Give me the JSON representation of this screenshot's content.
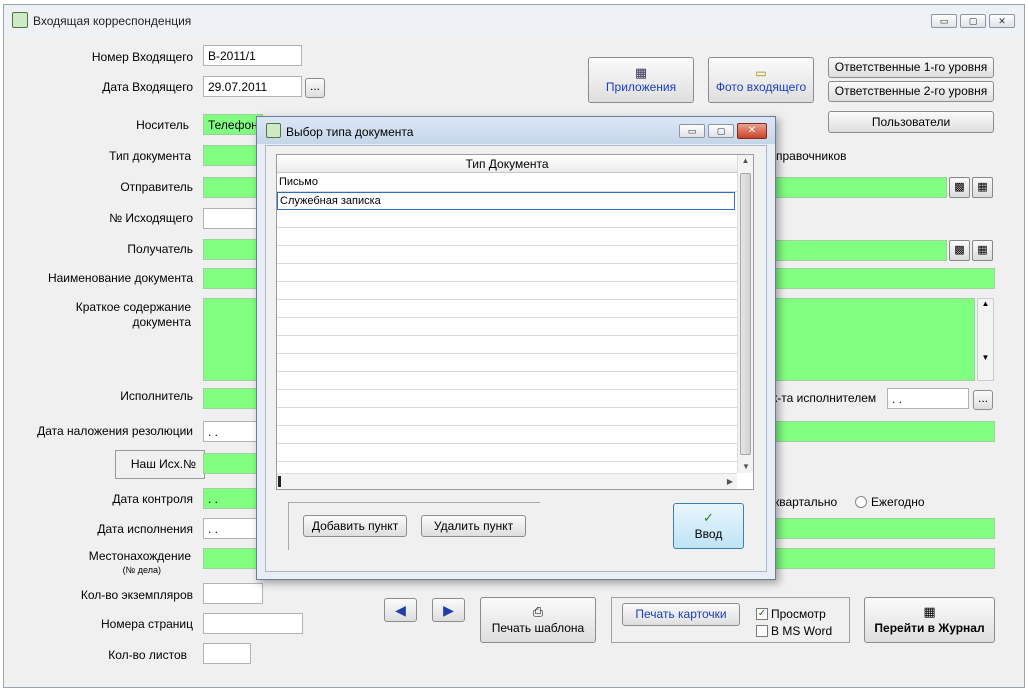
{
  "window": {
    "title": "Входящая корреспонденция",
    "controls": [
      "▭",
      "▢",
      "✕"
    ]
  },
  "labels": {
    "nomer": "Номер Входящего",
    "data": "Дата Входящего",
    "nositel": "Носитель",
    "tip": "Тип документа",
    "otpravitel": "Отправитель",
    "nomer_ish": "№ Исходящего",
    "poluchatel": "Получатель",
    "naimenovanie": "Наименование документа",
    "kratkoe1": "Краткое содержание",
    "kratkoe2": "документа",
    "ispolnitel": "Исполнитель",
    "data_rez": "Дата наложения резолюции",
    "nash_ish": "Наш Исх.№",
    "data_kontrol": "Дата контроля",
    "data_isp": "Дата исполнения",
    "mesto": "Местонахождение",
    "mesto_sub": "(№ дела)",
    "kol_ekz": "Кол-во экземпляров",
    "nomera_str": "Номера страниц",
    "kol_list": "Кол-во листов",
    "spravochnikov": "правочников",
    "ispolnitelem": "к-та исполнителем",
    "kvartalno": "квартально",
    "ezhegodno": "Ежегодно"
  },
  "values": {
    "nomer": "В-2011/1",
    "data": "29.07.2011",
    "nositel": "Телефон",
    "data_rez": " . .",
    "data_kontrol": " . .",
    "data_isp": " . .",
    "ispolnitelem_date": "  . ."
  },
  "buttons": {
    "ellipsis": "...",
    "prilozheniya": "Приложения",
    "foto": "Фото входящего",
    "otv1": "Ответственные 1-го уровня",
    "otv2": "Ответственные 2-го уровня",
    "polzovateli": "Пользователи",
    "pechat_shablona": "Печать шаблона",
    "pechat_kartochki": "Печать карточки",
    "perejti": "Перейти в Журнал"
  },
  "checks": {
    "prosmotr": "Просмотр",
    "ms_word": "В MS Word"
  },
  "dialog": {
    "title": "Выбор типа документа",
    "column_header": "Тип Документа",
    "rows": [
      "Письмо",
      "Служебная записка",
      "",
      "",
      "",
      "",
      "",
      "",
      "",
      "",
      "",
      "",
      "",
      "",
      "",
      ""
    ],
    "add": "Добавить пункт",
    "remove": "Удалить пункт",
    "enter": "Ввод"
  }
}
